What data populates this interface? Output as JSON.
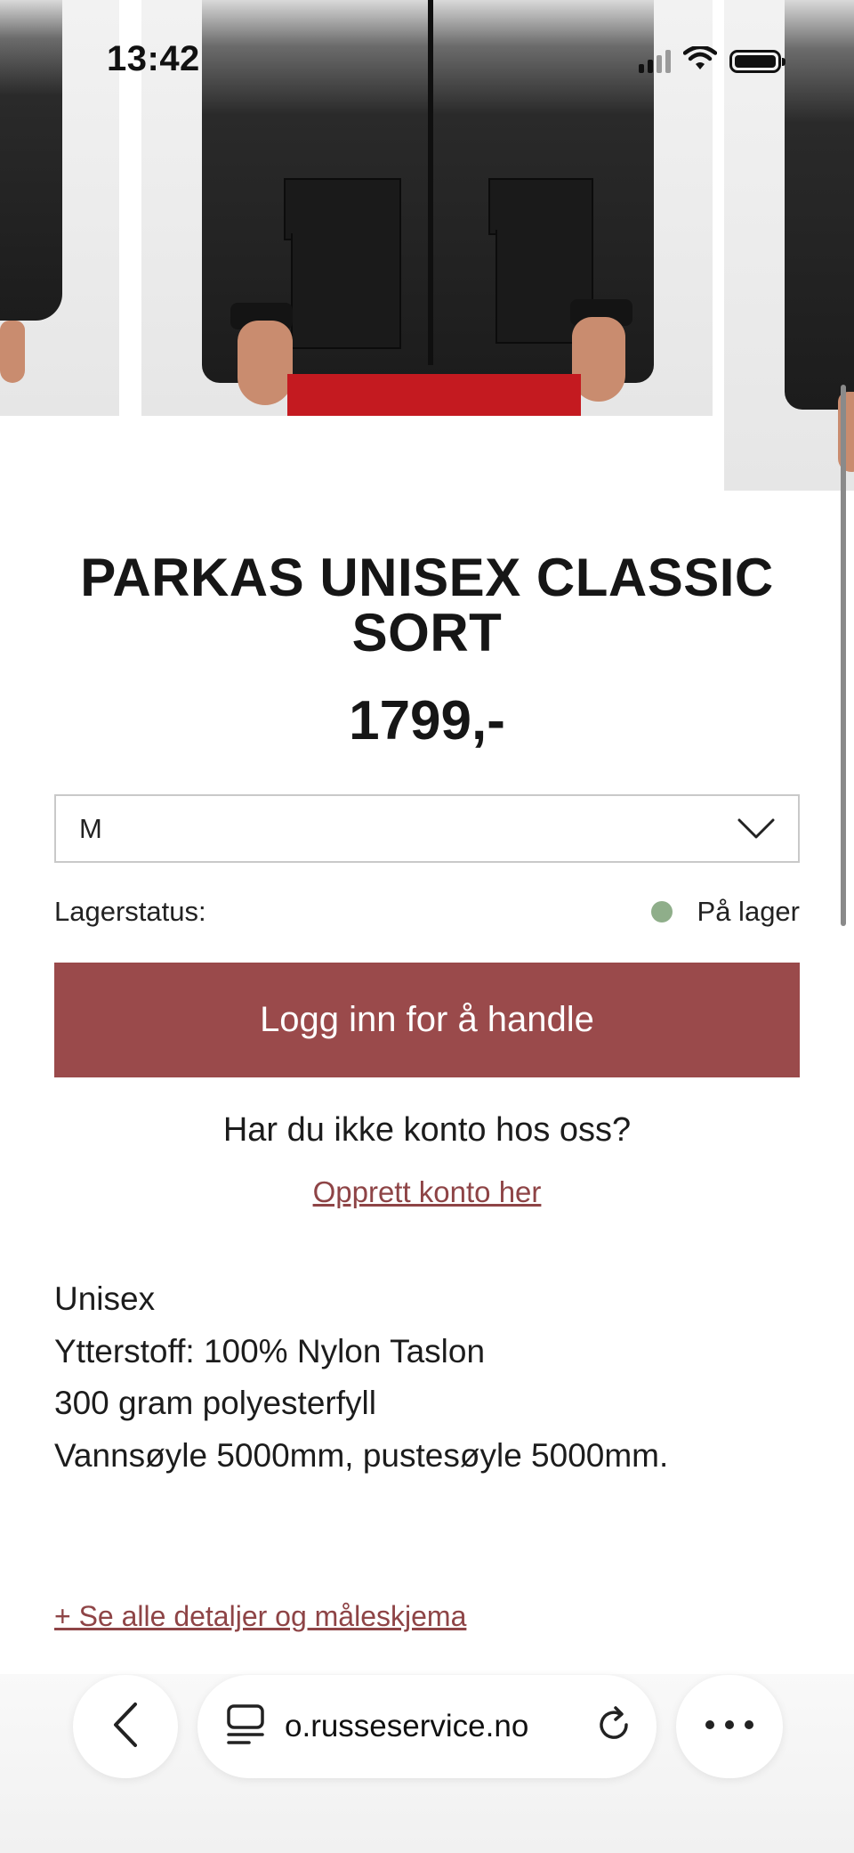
{
  "status_bar": {
    "time": "13:42"
  },
  "product": {
    "title": "PARKAS UNISEX CLASSIC SORT",
    "price": "1799,-",
    "size_selected": "M",
    "stock_label": "Lagerstatus:",
    "stock_status": "På lager",
    "stock_status_color": "#8fae8a"
  },
  "actions": {
    "login_button": "Logg inn for å handle",
    "no_account_text": "Har du ikke konto hos oss?",
    "create_account_link": "Opprett konto her"
  },
  "description": {
    "lines": [
      "Unisex",
      "Ytterstoff: 100% Nylon Taslon",
      "300 gram polyesterfyll",
      "Vannsøyle 5000mm, pustesøyle 5000mm."
    ]
  },
  "details_link": "+ Se alle detaljer og måleskjema",
  "browser": {
    "url": "o.russeservice.no"
  },
  "colors": {
    "accent": "#9a4a4b",
    "link": "#8e4446"
  }
}
